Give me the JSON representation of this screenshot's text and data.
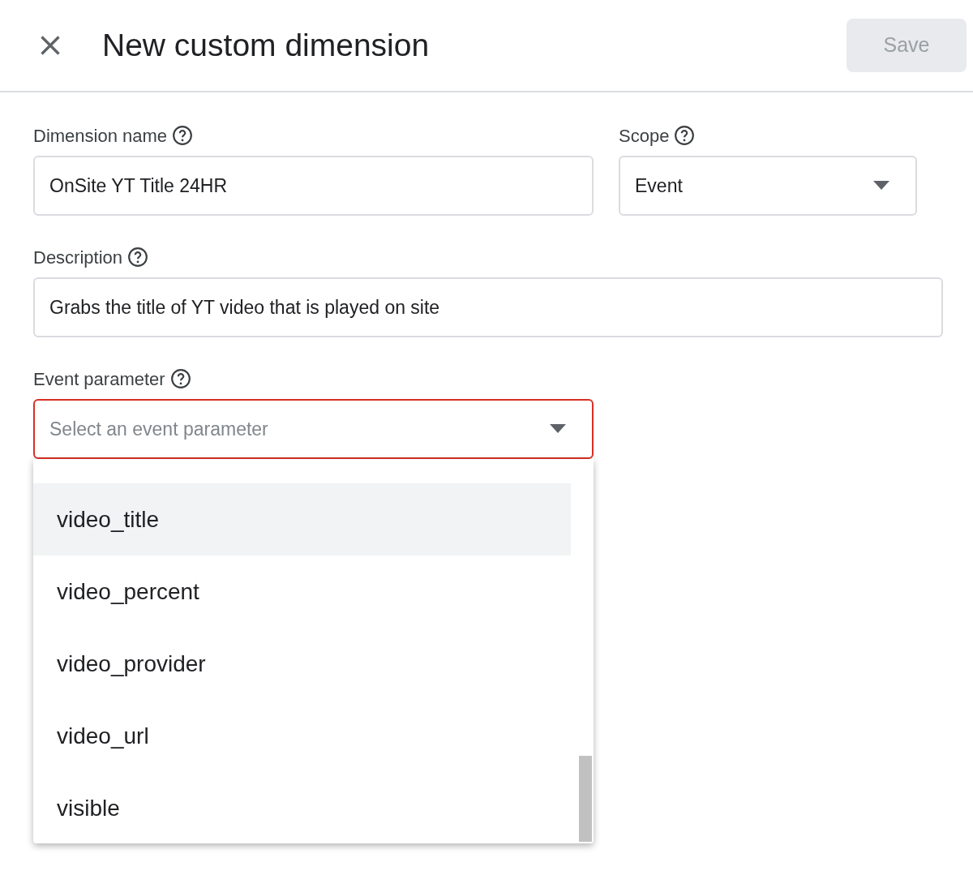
{
  "header": {
    "title": "New custom dimension",
    "save_button": {
      "label": "Save",
      "disabled": true
    }
  },
  "fields": [
    {
      "kind": "text",
      "label": "Dimension name",
      "value": "OnSite YT Title 24HR"
    },
    {
      "kind": "select",
      "label": "Scope",
      "value": "Event"
    },
    {
      "kind": "text",
      "label": "Description",
      "value": "Grabs the title of YT video that is played on site"
    },
    {
      "kind": "select",
      "label": "Event parameter",
      "placeholder": "Select an event parameter",
      "invalid": true
    }
  ],
  "dropdown": {
    "options": [
      {
        "label": "video_title",
        "highlighted": true
      },
      {
        "label": "video_percent",
        "highlighted": false
      },
      {
        "label": "video_provider",
        "highlighted": false
      },
      {
        "label": "video_url",
        "highlighted": false
      },
      {
        "label": "visible",
        "highlighted": false
      }
    ]
  }
}
